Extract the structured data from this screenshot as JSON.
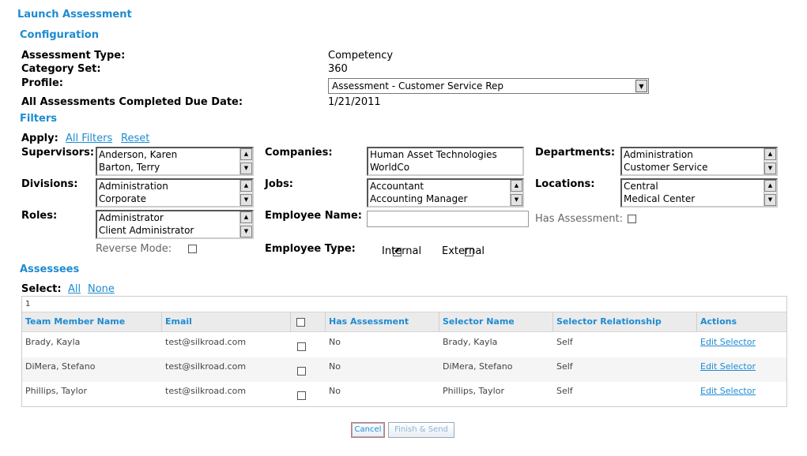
{
  "page": {
    "title": "Launch Assessment"
  },
  "configuration": {
    "heading": "Configuration",
    "assessment_type_label": "Assessment Type:",
    "assessment_type_value": "Competency",
    "category_set_label": "Category Set:",
    "category_set_value": "360",
    "profile_label": "Profile:",
    "profile_value": "Assessment - Customer Service Rep",
    "due_date_label": "All Assessments Completed Due Date:",
    "due_date_value": "1/21/2011"
  },
  "filters": {
    "heading": "Filters",
    "apply_label": "Apply:",
    "all_filters_link": "All Filters",
    "reset_link": "Reset",
    "supervisors": {
      "label": "Supervisors:",
      "options": [
        "Anderson, Karen",
        "Barton, Terry"
      ]
    },
    "companies": {
      "label": "Companies:",
      "options": [
        "Human Asset Technologies",
        "WorldCo"
      ]
    },
    "departments": {
      "label": "Departments:",
      "options": [
        "Administration",
        "Customer Service"
      ]
    },
    "divisions": {
      "label": "Divisions:",
      "options": [
        "Administration",
        "Corporate"
      ]
    },
    "jobs": {
      "label": "Jobs:",
      "options": [
        "Accountant",
        "Accounting Manager"
      ]
    },
    "locations": {
      "label": "Locations:",
      "options": [
        "Central",
        "Medical Center"
      ]
    },
    "roles": {
      "label": "Roles:",
      "options": [
        "Administrator",
        "Client Administrator"
      ]
    },
    "employee_name_label": "Employee Name:",
    "employee_name_value": "",
    "has_assessment_label": "Has Assessment:",
    "has_assessment_checked": false,
    "reverse_mode_label": "Reverse Mode:",
    "reverse_mode_checked": false,
    "employee_type_label": "Employee Type:",
    "internal_label": "Internal",
    "internal_checked": true,
    "external_label": "External",
    "external_checked": false
  },
  "assessees": {
    "heading": "Assessees",
    "select_label": "Select:",
    "all_link": "All",
    "none_link": "None",
    "page_number": "1",
    "columns": {
      "team_member_name": "Team Member Name",
      "email": "Email",
      "has_assessment": "Has Assessment",
      "selector_name": "Selector Name",
      "selector_relationship": "Selector Relationship",
      "actions": "Actions"
    },
    "rows": [
      {
        "name": "Brady, Kayla",
        "email": "test@silkroad.com",
        "checked": false,
        "has_assessment": "No",
        "selector_name": "Brady, Kayla",
        "relationship": "Self",
        "action": "Edit Selector"
      },
      {
        "name": "DiMera, Stefano",
        "email": "test@silkroad.com",
        "checked": false,
        "has_assessment": "No",
        "selector_name": "DiMera, Stefano",
        "relationship": "Self",
        "action": "Edit Selector"
      },
      {
        "name": "Phillips, Taylor",
        "email": "test@silkroad.com",
        "checked": false,
        "has_assessment": "No",
        "selector_name": "Phillips, Taylor",
        "relationship": "Self",
        "action": "Edit Selector"
      }
    ]
  },
  "buttons": {
    "cancel": "Cancel",
    "finish_send": "Finish & Send"
  },
  "colors": {
    "accent": "#1e8bd2"
  }
}
